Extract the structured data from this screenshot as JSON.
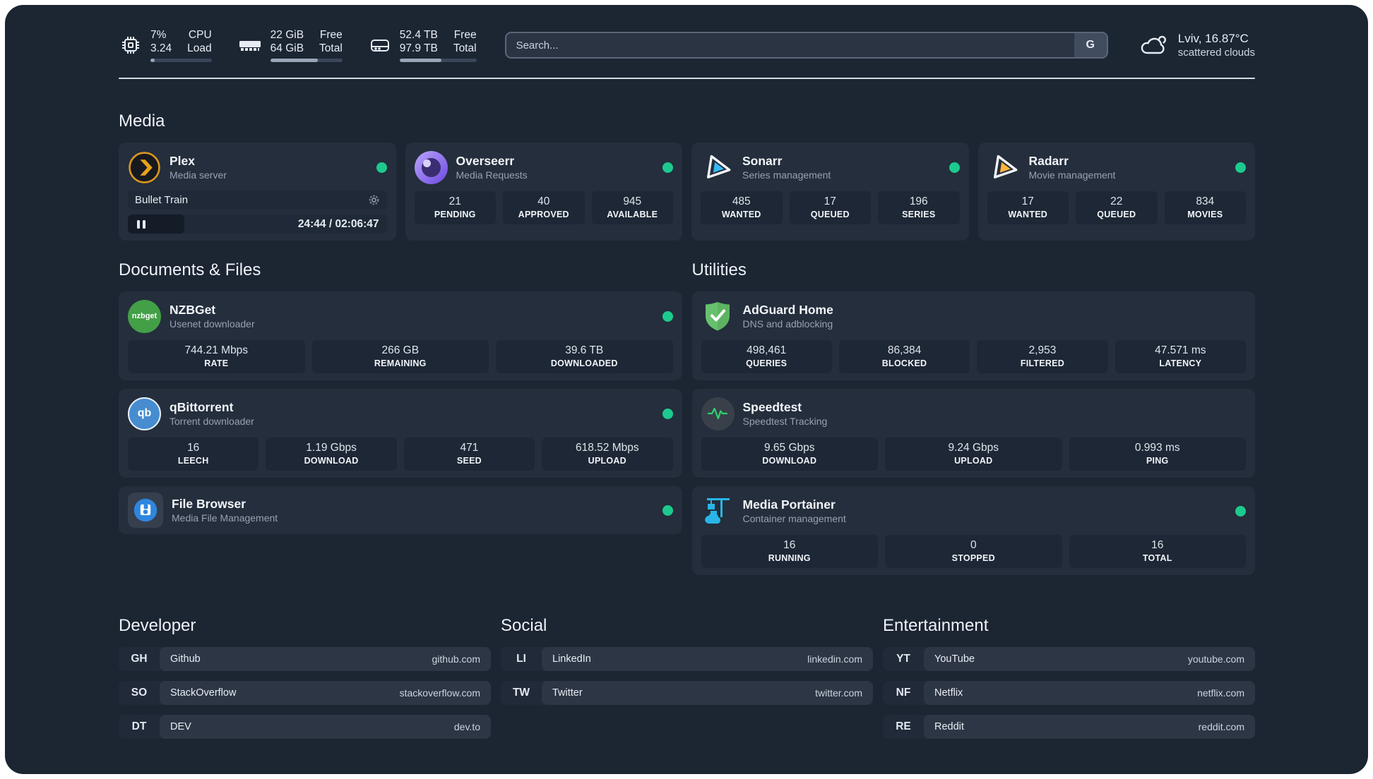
{
  "header": {
    "metrics": [
      {
        "icon": "cpu",
        "value_top": "7%",
        "value_bottom": "3.24",
        "label_top": "CPU",
        "label_bottom": "Load",
        "progress_pct": 7
      },
      {
        "icon": "memory",
        "value_top": "22 GiB",
        "value_bottom": "64 GiB",
        "label_top": "Free",
        "label_bottom": "Total",
        "progress_pct": 66
      },
      {
        "icon": "disk",
        "value_top": "52.4 TB",
        "value_bottom": "97.9 TB",
        "label_top": "Free",
        "label_bottom": "Total",
        "progress_pct": 54
      }
    ],
    "search": {
      "placeholder": "Search...",
      "engine_label": "G"
    },
    "weather": {
      "location": "Lviv, 16.87°C",
      "condition": "scattered clouds"
    }
  },
  "media": {
    "title": "Media",
    "cards": [
      {
        "name": "Plex",
        "subtitle": "Media server",
        "icon": "plex-logo",
        "status_color": "#1dca8e",
        "player": {
          "now_playing": "Bullet Train",
          "time": "24:44 / 02:06:47"
        }
      },
      {
        "name": "Overseerr",
        "subtitle": "Media Requests",
        "icon": "overseerr-logo",
        "status_color": "#1dca8e",
        "stats": [
          {
            "value": "21",
            "label": "PENDING"
          },
          {
            "value": "40",
            "label": "APPROVED"
          },
          {
            "value": "945",
            "label": "AVAILABLE"
          }
        ]
      },
      {
        "name": "Sonarr",
        "subtitle": "Series management",
        "icon": "sonarr-logo",
        "status_color": "#1dca8e",
        "stats": [
          {
            "value": "485",
            "label": "WANTED"
          },
          {
            "value": "17",
            "label": "QUEUED"
          },
          {
            "value": "196",
            "label": "SERIES"
          }
        ]
      },
      {
        "name": "Radarr",
        "subtitle": "Movie management",
        "icon": "radarr-logo",
        "status_color": "#1dca8e",
        "stats": [
          {
            "value": "17",
            "label": "WANTED"
          },
          {
            "value": "22",
            "label": "QUEUED"
          },
          {
            "value": "834",
            "label": "MOVIES"
          }
        ]
      }
    ]
  },
  "documents": {
    "title": "Documents & Files",
    "cards": [
      {
        "name": "NZBGet",
        "subtitle": "Usenet downloader",
        "icon": "nzbget-logo",
        "status_color": "#1dca8e",
        "stats": [
          {
            "value": "744.21 Mbps",
            "label": "RATE"
          },
          {
            "value": "266 GB",
            "label": "REMAINING"
          },
          {
            "value": "39.6 TB",
            "label": "DOWNLOADED"
          }
        ]
      },
      {
        "name": "qBittorrent",
        "subtitle": "Torrent downloader",
        "icon": "qbittorrent-logo",
        "status_color": "#1dca8e",
        "stats": [
          {
            "value": "16",
            "label": "LEECH"
          },
          {
            "value": "1.19 Gbps",
            "label": "DOWNLOAD"
          },
          {
            "value": "471",
            "label": "SEED"
          },
          {
            "value": "618.52 Mbps",
            "label": "UPLOAD"
          }
        ]
      },
      {
        "name": "File Browser",
        "subtitle": "Media File Management",
        "icon": "filebrowser-logo",
        "status_color": "#1dca8e"
      }
    ]
  },
  "utilities": {
    "title": "Utilities",
    "cards": [
      {
        "name": "AdGuard Home",
        "subtitle": "DNS and adblocking",
        "icon": "adguard-logo",
        "stats": [
          {
            "value": "498,461",
            "label": "QUERIES"
          },
          {
            "value": "86,384",
            "label": "BLOCKED"
          },
          {
            "value": "2,953",
            "label": "FILTERED"
          },
          {
            "value": "47.571 ms",
            "label": "LATENCY"
          }
        ]
      },
      {
        "name": "Speedtest",
        "subtitle": "Speedtest Tracking",
        "icon": "speedtest-logo",
        "stats": [
          {
            "value": "9.65 Gbps",
            "label": "DOWNLOAD"
          },
          {
            "value": "9.24 Gbps",
            "label": "UPLOAD"
          },
          {
            "value": "0.993 ms",
            "label": "PING"
          }
        ]
      },
      {
        "name": "Media Portainer",
        "subtitle": "Container management",
        "icon": "portainer-logo",
        "status_color": "#1dca8e",
        "stats": [
          {
            "value": "16",
            "label": "RUNNING"
          },
          {
            "value": "0",
            "label": "STOPPED"
          },
          {
            "value": "16",
            "label": "TOTAL"
          }
        ]
      }
    ]
  },
  "links": {
    "groups": [
      {
        "title": "Developer",
        "items": [
          {
            "abbr": "GH",
            "name": "Github",
            "url": "github.com"
          },
          {
            "abbr": "SO",
            "name": "StackOverflow",
            "url": "stackoverflow.com"
          },
          {
            "abbr": "DT",
            "name": "DEV",
            "url": "dev.to"
          }
        ]
      },
      {
        "title": "Social",
        "items": [
          {
            "abbr": "LI",
            "name": "LinkedIn",
            "url": "linkedin.com"
          },
          {
            "abbr": "TW",
            "name": "Twitter",
            "url": "twitter.com"
          }
        ]
      },
      {
        "title": "Entertainment",
        "items": [
          {
            "abbr": "YT",
            "name": "YouTube",
            "url": "youtube.com"
          },
          {
            "abbr": "NF",
            "name": "Netflix",
            "url": "netflix.com"
          },
          {
            "abbr": "RE",
            "name": "Reddit",
            "url": "reddit.com"
          }
        ]
      }
    ]
  },
  "colors": {
    "background": "#1c2532",
    "card": "#242e3c",
    "stat_box": "#1d2735",
    "status_online": "#1dca8e",
    "accent_cyan": "#29b5e8"
  }
}
